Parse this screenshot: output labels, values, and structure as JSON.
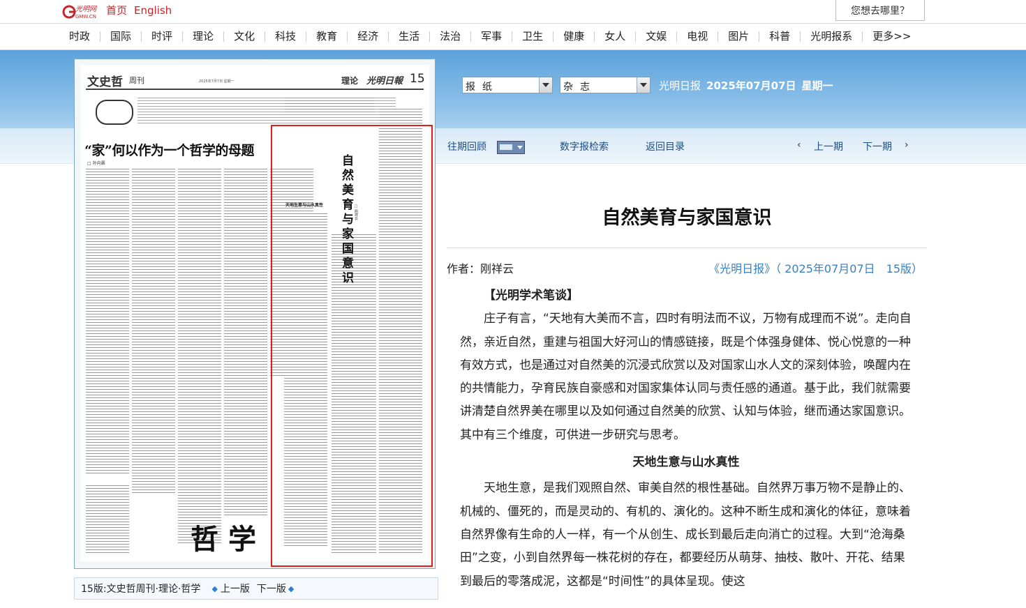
{
  "top": {
    "home": "首页",
    "english": "English",
    "search_prompt": "您想去哪里？"
  },
  "nav": [
    "时政",
    "国际",
    "时评",
    "理论",
    "文化",
    "科技",
    "教育",
    "经济",
    "生活",
    "法治",
    "军事",
    "卫生",
    "健康",
    "女人",
    "文娱",
    "电视",
    "图片",
    "科普",
    "光明报系",
    "更多>>"
  ],
  "selectors": {
    "newspaper": "报纸",
    "magazine": "杂志"
  },
  "dateline": {
    "paper": "光明日报",
    "date": "2025年07月07日",
    "weekday": "星期一"
  },
  "tools": {
    "archive": "往期回顾",
    "search": "数字报检索",
    "back": "返回目录",
    "prev": "上一期",
    "next": "下一期"
  },
  "page_image": {
    "masthead": "文史哲",
    "weekly": "周刊",
    "issue_line": "2025年7月7日 星期一",
    "section": "理论",
    "paper_name": "光明日報",
    "number": "15",
    "headline": "“家”何以作为一个哲学的母题",
    "byline": "□ 孙向晨",
    "vertical_title": "自然美育与家国意识",
    "vertical_author": "□ 刚祥云",
    "subhead": "天地生意与山水真性",
    "footer_art": "哲学"
  },
  "page_bar": {
    "label": "15版:文史哲周刊·理论·哲学",
    "prev": "上一版",
    "next": "下一版"
  },
  "article": {
    "title": "自然美育与家国意识",
    "author": "作者：刚祥云",
    "source": "《光明日报》（ 2025年07月07日　15版）",
    "column": "【光明学术笔谈】",
    "p1": "庄子有言，“天地有大美而不言，四时有明法而不议，万物有成理而不说”。走向自然，亲近自然，重建与祖国大好河山的情感链接，既是个体强身健体、悦心悦意的一种有效方式，也是通过对自然美的沉浸式欣赏以及对国家山水人文的深刻体验，唤醒内在的共情能力，孕育民族自豪感和对国家集体认同与责任感的通道。基于此，我们就需要讲清楚自然界美在哪里以及如何通过自然美的欣赏、认知与体验，继而通达家国意识。其中有三个维度，可供进一步研究与思考。",
    "subhead": "天地生意与山水真性",
    "p2": "天地生意，是我们观照自然、审美自然的根性基础。自然界万事万物不是静止的、机械的、僵死的，而是灵动的、有机的、演化的。这种不断生成和演化的体征，意味着自然界像有生命的人一样，有一个从创生、成长到最后走向消亡的过程。大到“沧海桑田”之变，小到自然界每一株花树的存在，都要经历从萌芽、抽枝、散叶、开花、结果到最后的零落成泥，这都是“时间性”的具体呈现。使这"
  }
}
